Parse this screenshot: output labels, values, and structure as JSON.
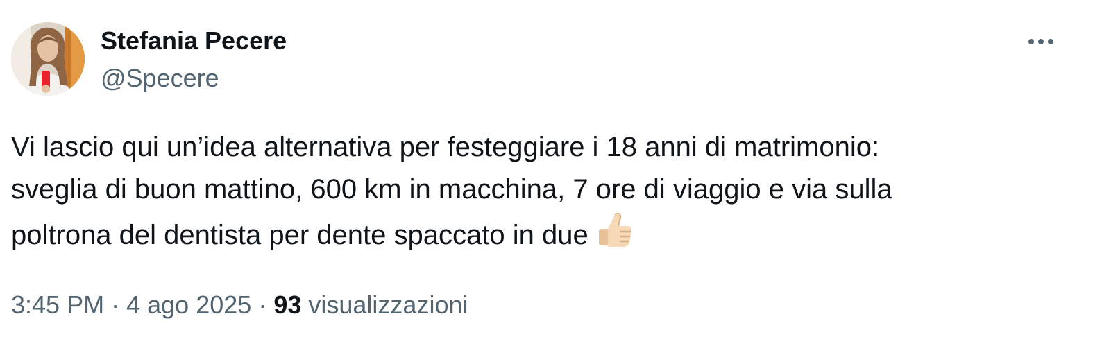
{
  "author": {
    "display_name": "Stefania Pecere",
    "handle": "@Specere",
    "avatar_icon": "profile-photo"
  },
  "tweet": {
    "text": "Vi lascio qui un’idea alternativa per festeggiare i 18 anni di matrimonio:\nsveglia di buon mattino, 600 km in macchina, 7 ore di viaggio e via sulla\npoltrona del dentista per dente spaccato in due",
    "emoji_icon": "thumbs-up-light-skin-tone"
  },
  "meta": {
    "time": "3:45 PM",
    "separator": "·",
    "date": "4 ago 2025",
    "views_count": "93",
    "views_label": "visualizzazioni"
  },
  "colors": {
    "primary_text": "#0f1419",
    "secondary_text": "#536471",
    "background": "#ffffff"
  }
}
